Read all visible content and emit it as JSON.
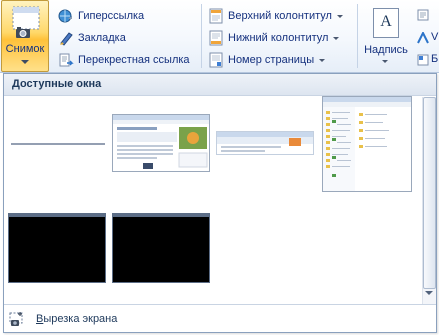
{
  "ribbon": {
    "snapshot_label": "Снимок",
    "links": {
      "hyperlink": "Гиперссылка",
      "bookmark": "Закладка",
      "cross_reference": "Перекрестная ссылка"
    },
    "header_footer": {
      "header": "Верхний колонтитул",
      "footer": "Нижний колонтитул",
      "page_number": "Номер страницы"
    },
    "text": {
      "textbox_label": "Надпись",
      "textbox_icon_glyph": "A",
      "partial_labels": [
        "V",
        "Б"
      ]
    }
  },
  "gallery": {
    "header": "Доступные окна",
    "windows": [
      {
        "kind": "blank-line"
      },
      {
        "kind": "webpage"
      },
      {
        "kind": "toolbar-strip"
      },
      {
        "kind": "file-explorer"
      },
      {
        "kind": "black-console"
      },
      {
        "kind": "black-console"
      }
    ],
    "screen_clipping_first_letter": "В",
    "screen_clipping_rest": "ырезка экрана"
  },
  "colors": {
    "accent_orange": "#ffc23a",
    "ribbon_text": "#15317e",
    "border": "#8aa0bd"
  }
}
